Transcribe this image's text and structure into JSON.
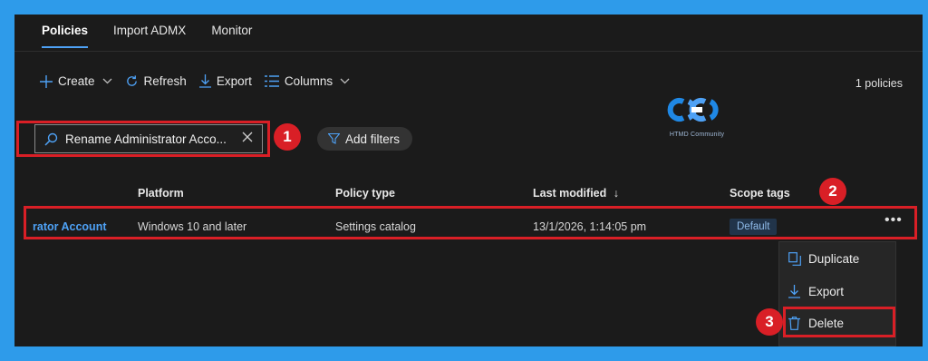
{
  "tabs": [
    {
      "label": "Policies",
      "active": true
    },
    {
      "label": "Import ADMX",
      "active": false
    },
    {
      "label": "Monitor",
      "active": false
    }
  ],
  "toolbar": {
    "create_label": "Create",
    "refresh_label": "Refresh",
    "export_label": "Export",
    "columns_label": "Columns",
    "count_label": "1 policies"
  },
  "search": {
    "value": "Rename Administrator Acco..."
  },
  "filters": {
    "add_label": "Add filters"
  },
  "logo": {
    "caption": "HTMD Community"
  },
  "table": {
    "headers": {
      "platform": "Platform",
      "policy_type": "Policy type",
      "last_modified": "Last modified",
      "sort_indicator": "↓",
      "scope_tags": "Scope tags"
    },
    "rows": [
      {
        "name": "rator Account",
        "platform": "Windows 10 and later",
        "policy_type": "Settings catalog",
        "last_modified": "13/1/2026, 1:14:05 pm",
        "scope_tag": "Default"
      }
    ]
  },
  "context_menu": {
    "items": [
      {
        "label": "Duplicate",
        "icon": "duplicate-icon"
      },
      {
        "label": "Export",
        "icon": "download-icon"
      },
      {
        "label": "Delete",
        "icon": "trash-icon"
      }
    ]
  },
  "annotations": {
    "step1": "1",
    "step2": "2",
    "step3": "3"
  },
  "colors": {
    "accent": "#4ea1f5",
    "annotation": "#d91f26",
    "frame": "#2e9bea",
    "background": "#1b1b1b"
  }
}
